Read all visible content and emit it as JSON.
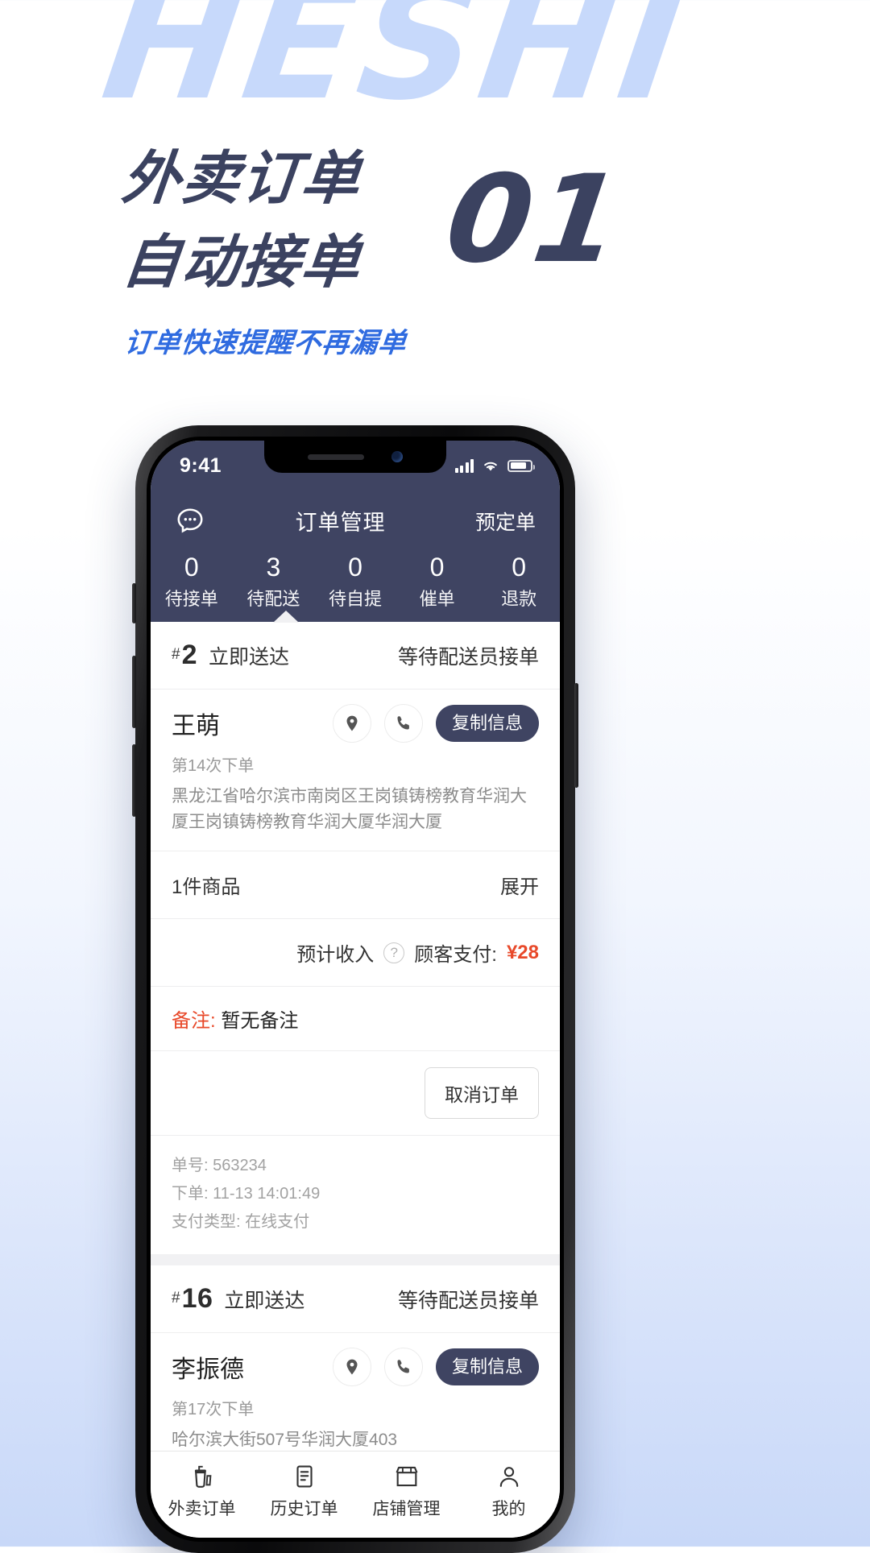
{
  "poster": {
    "watermark": "HESHI",
    "headline_line1": "外卖订单",
    "headline_line2": "自动接单",
    "subtitle": "订单快速提醒不再漏单",
    "step_number": "01",
    "accent_blue": "#2f6be0",
    "navy": "#3b4260",
    "watermark_color": "#c7d9fb"
  },
  "statusbar": {
    "time": "9:41",
    "signal_icon": "signal-bars-icon",
    "wifi_icon": "wifi-icon",
    "battery_icon": "battery-icon"
  },
  "header": {
    "chat_icon": "chat-bubble-icon",
    "title": "订单管理",
    "right_action": "预定单",
    "background": "#3f4462"
  },
  "tabs": [
    {
      "count": "0",
      "label": "待接单",
      "active": false
    },
    {
      "count": "3",
      "label": "待配送",
      "active": true
    },
    {
      "count": "0",
      "label": "待自提",
      "active": false
    },
    {
      "count": "0",
      "label": "催单",
      "active": false
    },
    {
      "count": "0",
      "label": "退款",
      "active": false
    }
  ],
  "orders": [
    {
      "hash": "#",
      "seq": "2",
      "deliver_type": "立即送达",
      "status": "等待配送员接单",
      "customer_name": "王萌",
      "location_icon": "location-pin-icon",
      "phone_icon": "phone-icon",
      "copy_label": "复制信息",
      "order_times": "第14次下单",
      "address": "黑龙江省哈尔滨市南岗区王岗镇铸榜教育华润大厦王岗镇铸榜教育华润大厦华润大厦",
      "goods_count": "1件商品",
      "expand_label": "展开",
      "income_label": "预计收入",
      "help_icon": "question-mark-icon",
      "paid_label": "顾客支付:",
      "paid_amount": "¥28",
      "note_key": "备注:",
      "note_value": "暂无备注",
      "cancel_label": "取消订单",
      "detail_order_no": "单号: 563234",
      "detail_time": "下单: 11-13 14:01:49",
      "detail_pay": "支付类型: 在线支付"
    },
    {
      "hash": "#",
      "seq": "16",
      "deliver_type": "立即送达",
      "status": "等待配送员接单",
      "customer_name": "李振德",
      "location_icon": "location-pin-icon",
      "phone_icon": "phone-icon",
      "copy_label": "复制信息",
      "order_times": "第17次下单",
      "address": "哈尔滨大街507号华润大厦403"
    }
  ],
  "bottom_nav": [
    {
      "icon": "takeaway-cup-icon",
      "label": "外卖订单",
      "active": true
    },
    {
      "icon": "history-list-icon",
      "label": "历史订单",
      "active": false
    },
    {
      "icon": "store-icon",
      "label": "店铺管理",
      "active": false
    },
    {
      "icon": "user-icon",
      "label": "我的",
      "active": false
    }
  ]
}
